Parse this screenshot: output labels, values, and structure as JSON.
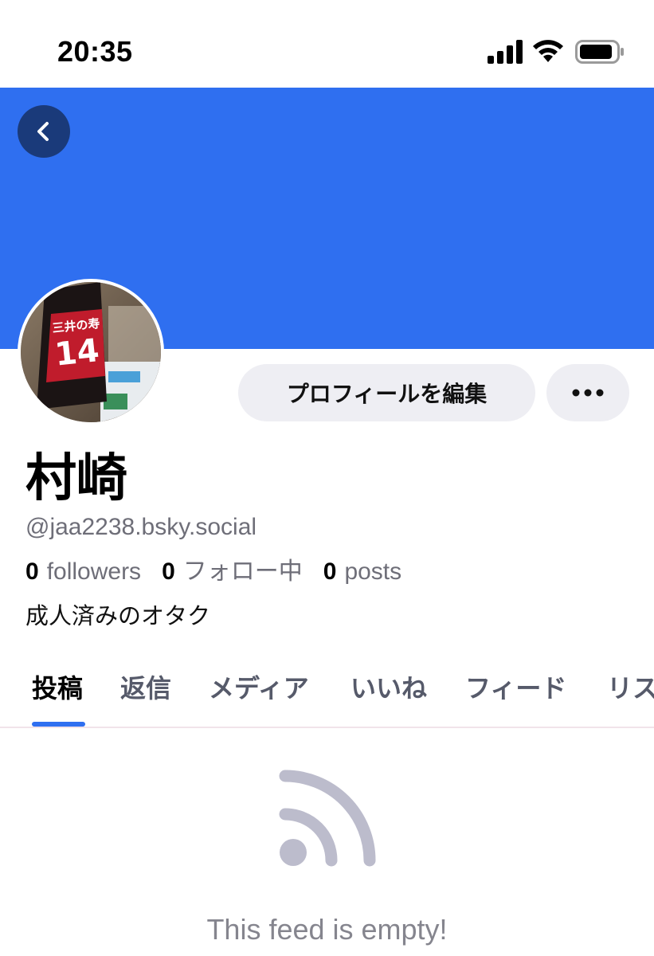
{
  "status_bar": {
    "time": "20:35",
    "icons": [
      "signal-icon",
      "wifi-icon",
      "battery-icon"
    ]
  },
  "colors": {
    "banner": "#2f6ff0",
    "accent": "#2f6ff0",
    "back_button": "#1a3a7a",
    "muted_text": "#6e6e78",
    "button_bg": "#eeeef3",
    "empty_icon": "#bcbccc"
  },
  "profile": {
    "display_name": "村崎",
    "handle": "@jaa2238.bsky.social",
    "bio": "成人済みのオタク",
    "avatar_label": "三井の寿",
    "avatar_number": "14"
  },
  "stats": [
    {
      "count": "0",
      "label": "followers"
    },
    {
      "count": "0",
      "label": "フォロー中"
    },
    {
      "count": "0",
      "label": "posts"
    }
  ],
  "actions": {
    "edit_profile": "プロフィールを編集",
    "more_icon": "ellipsis-icon",
    "back_icon": "chevron-left-icon"
  },
  "tabs": [
    {
      "label": "投稿",
      "active": true
    },
    {
      "label": "返信",
      "active": false
    },
    {
      "label": "メディア",
      "active": false
    },
    {
      "label": "いいね",
      "active": false
    },
    {
      "label": "フィード",
      "active": false
    },
    {
      "label": "リスト",
      "active": false
    }
  ],
  "feed": {
    "empty_icon": "rss-feed-icon",
    "empty_message": "This feed is empty!"
  }
}
